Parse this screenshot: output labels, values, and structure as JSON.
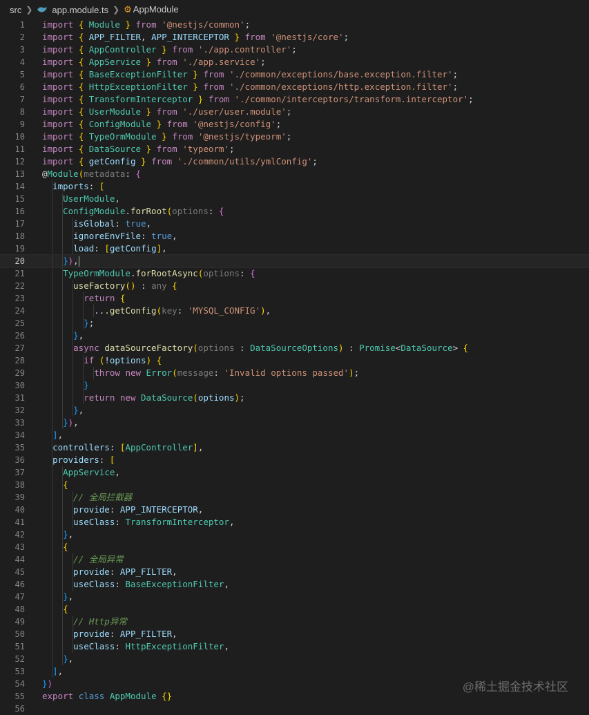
{
  "breadcrumb": {
    "folder": "src",
    "file": "app.module.ts",
    "symbol": "AppModule"
  },
  "watermark": "@稀土掘金技术社区",
  "colors": {
    "background": "#1e1e1e",
    "keyword": "#c586c0",
    "string": "#ce9178",
    "type": "#4ec9b0",
    "function": "#dcdcaa",
    "variable": "#9cdcfe"
  },
  "active_line": 20,
  "editor": {
    "lines": [
      {
        "n": "1",
        "t": "import { Module } from '@nestjs/common';"
      },
      {
        "n": "2",
        "t": "import { APP_FILTER, APP_INTERCEPTOR } from '@nestjs/core';"
      },
      {
        "n": "3",
        "t": "import { AppController } from './app.controller';"
      },
      {
        "n": "4",
        "t": "import { AppService } from './app.service';"
      },
      {
        "n": "5",
        "t": "import { BaseExceptionFilter } from './common/exceptions/base.exception.filter';"
      },
      {
        "n": "6",
        "t": "import { HttpExceptionFilter } from './common/exceptions/http.exception.filter';"
      },
      {
        "n": "7",
        "t": "import { TransformInterceptor } from './common/interceptors/transform.interceptor';"
      },
      {
        "n": "8",
        "t": "import { UserModule } from './user/user.module';"
      },
      {
        "n": "9",
        "t": "import { ConfigModule } from '@nestjs/config';"
      },
      {
        "n": "10",
        "t": "import { TypeOrmModule } from '@nestjs/typeorm';"
      },
      {
        "n": "11",
        "t": "import { DataSource } from 'typeorm';"
      },
      {
        "n": "12",
        "t": "import { getConfig } from './common/utils/ymlConfig';"
      },
      {
        "n": "13",
        "t": "@Module(metadata: {"
      },
      {
        "n": "14",
        "t": "  imports: ["
      },
      {
        "n": "15",
        "t": "    UserModule,"
      },
      {
        "n": "16",
        "t": "    ConfigModule.forRoot(options: {"
      },
      {
        "n": "17",
        "t": "      isGlobal: true,"
      },
      {
        "n": "18",
        "t": "      ignoreEnvFile: true,"
      },
      {
        "n": "19",
        "t": "      load: [getConfig],"
      },
      {
        "n": "20",
        "t": "    }),"
      },
      {
        "n": "21",
        "t": "    TypeOrmModule.forRootAsync(options: {"
      },
      {
        "n": "22",
        "t": "      useFactory() : any {"
      },
      {
        "n": "23",
        "t": "        return {"
      },
      {
        "n": "24",
        "t": "          ...getConfig(key: 'MYSQL_CONFIG'),"
      },
      {
        "n": "25",
        "t": "        };"
      },
      {
        "n": "26",
        "t": "      },"
      },
      {
        "n": "27",
        "t": "      async dataSourceFactory(options : DataSourceOptions) : Promise<DataSource> {"
      },
      {
        "n": "28",
        "t": "        if (!options) {"
      },
      {
        "n": "29",
        "t": "          throw new Error(message: 'Invalid options passed');"
      },
      {
        "n": "30",
        "t": "        }"
      },
      {
        "n": "31",
        "t": "        return new DataSource(options);"
      },
      {
        "n": "32",
        "t": "      },"
      },
      {
        "n": "33",
        "t": "    }),"
      },
      {
        "n": "34",
        "t": "  ],"
      },
      {
        "n": "35",
        "t": "  controllers: [AppController],"
      },
      {
        "n": "36",
        "t": "  providers: ["
      },
      {
        "n": "37",
        "t": "    AppService,"
      },
      {
        "n": "38",
        "t": "    {"
      },
      {
        "n": "39",
        "t": "      // 全局拦截器"
      },
      {
        "n": "40",
        "t": "      provide: APP_INTERCEPTOR,"
      },
      {
        "n": "41",
        "t": "      useClass: TransformInterceptor,"
      },
      {
        "n": "42",
        "t": "    },"
      },
      {
        "n": "43",
        "t": "    {"
      },
      {
        "n": "44",
        "t": "      // 全局异常"
      },
      {
        "n": "45",
        "t": "      provide: APP_FILTER,"
      },
      {
        "n": "46",
        "t": "      useClass: BaseExceptionFilter,"
      },
      {
        "n": "47",
        "t": "    },"
      },
      {
        "n": "48",
        "t": "    {"
      },
      {
        "n": "49",
        "t": "      // Http异常"
      },
      {
        "n": "50",
        "t": "      provide: APP_FILTER,"
      },
      {
        "n": "51",
        "t": "      useClass: HttpExceptionFilter,"
      },
      {
        "n": "52",
        "t": "    },"
      },
      {
        "n": "53",
        "t": "  ],"
      },
      {
        "n": "54",
        "t": "})"
      },
      {
        "n": "55",
        "t": "export class AppModule {}"
      },
      {
        "n": "56",
        "t": ""
      }
    ]
  }
}
